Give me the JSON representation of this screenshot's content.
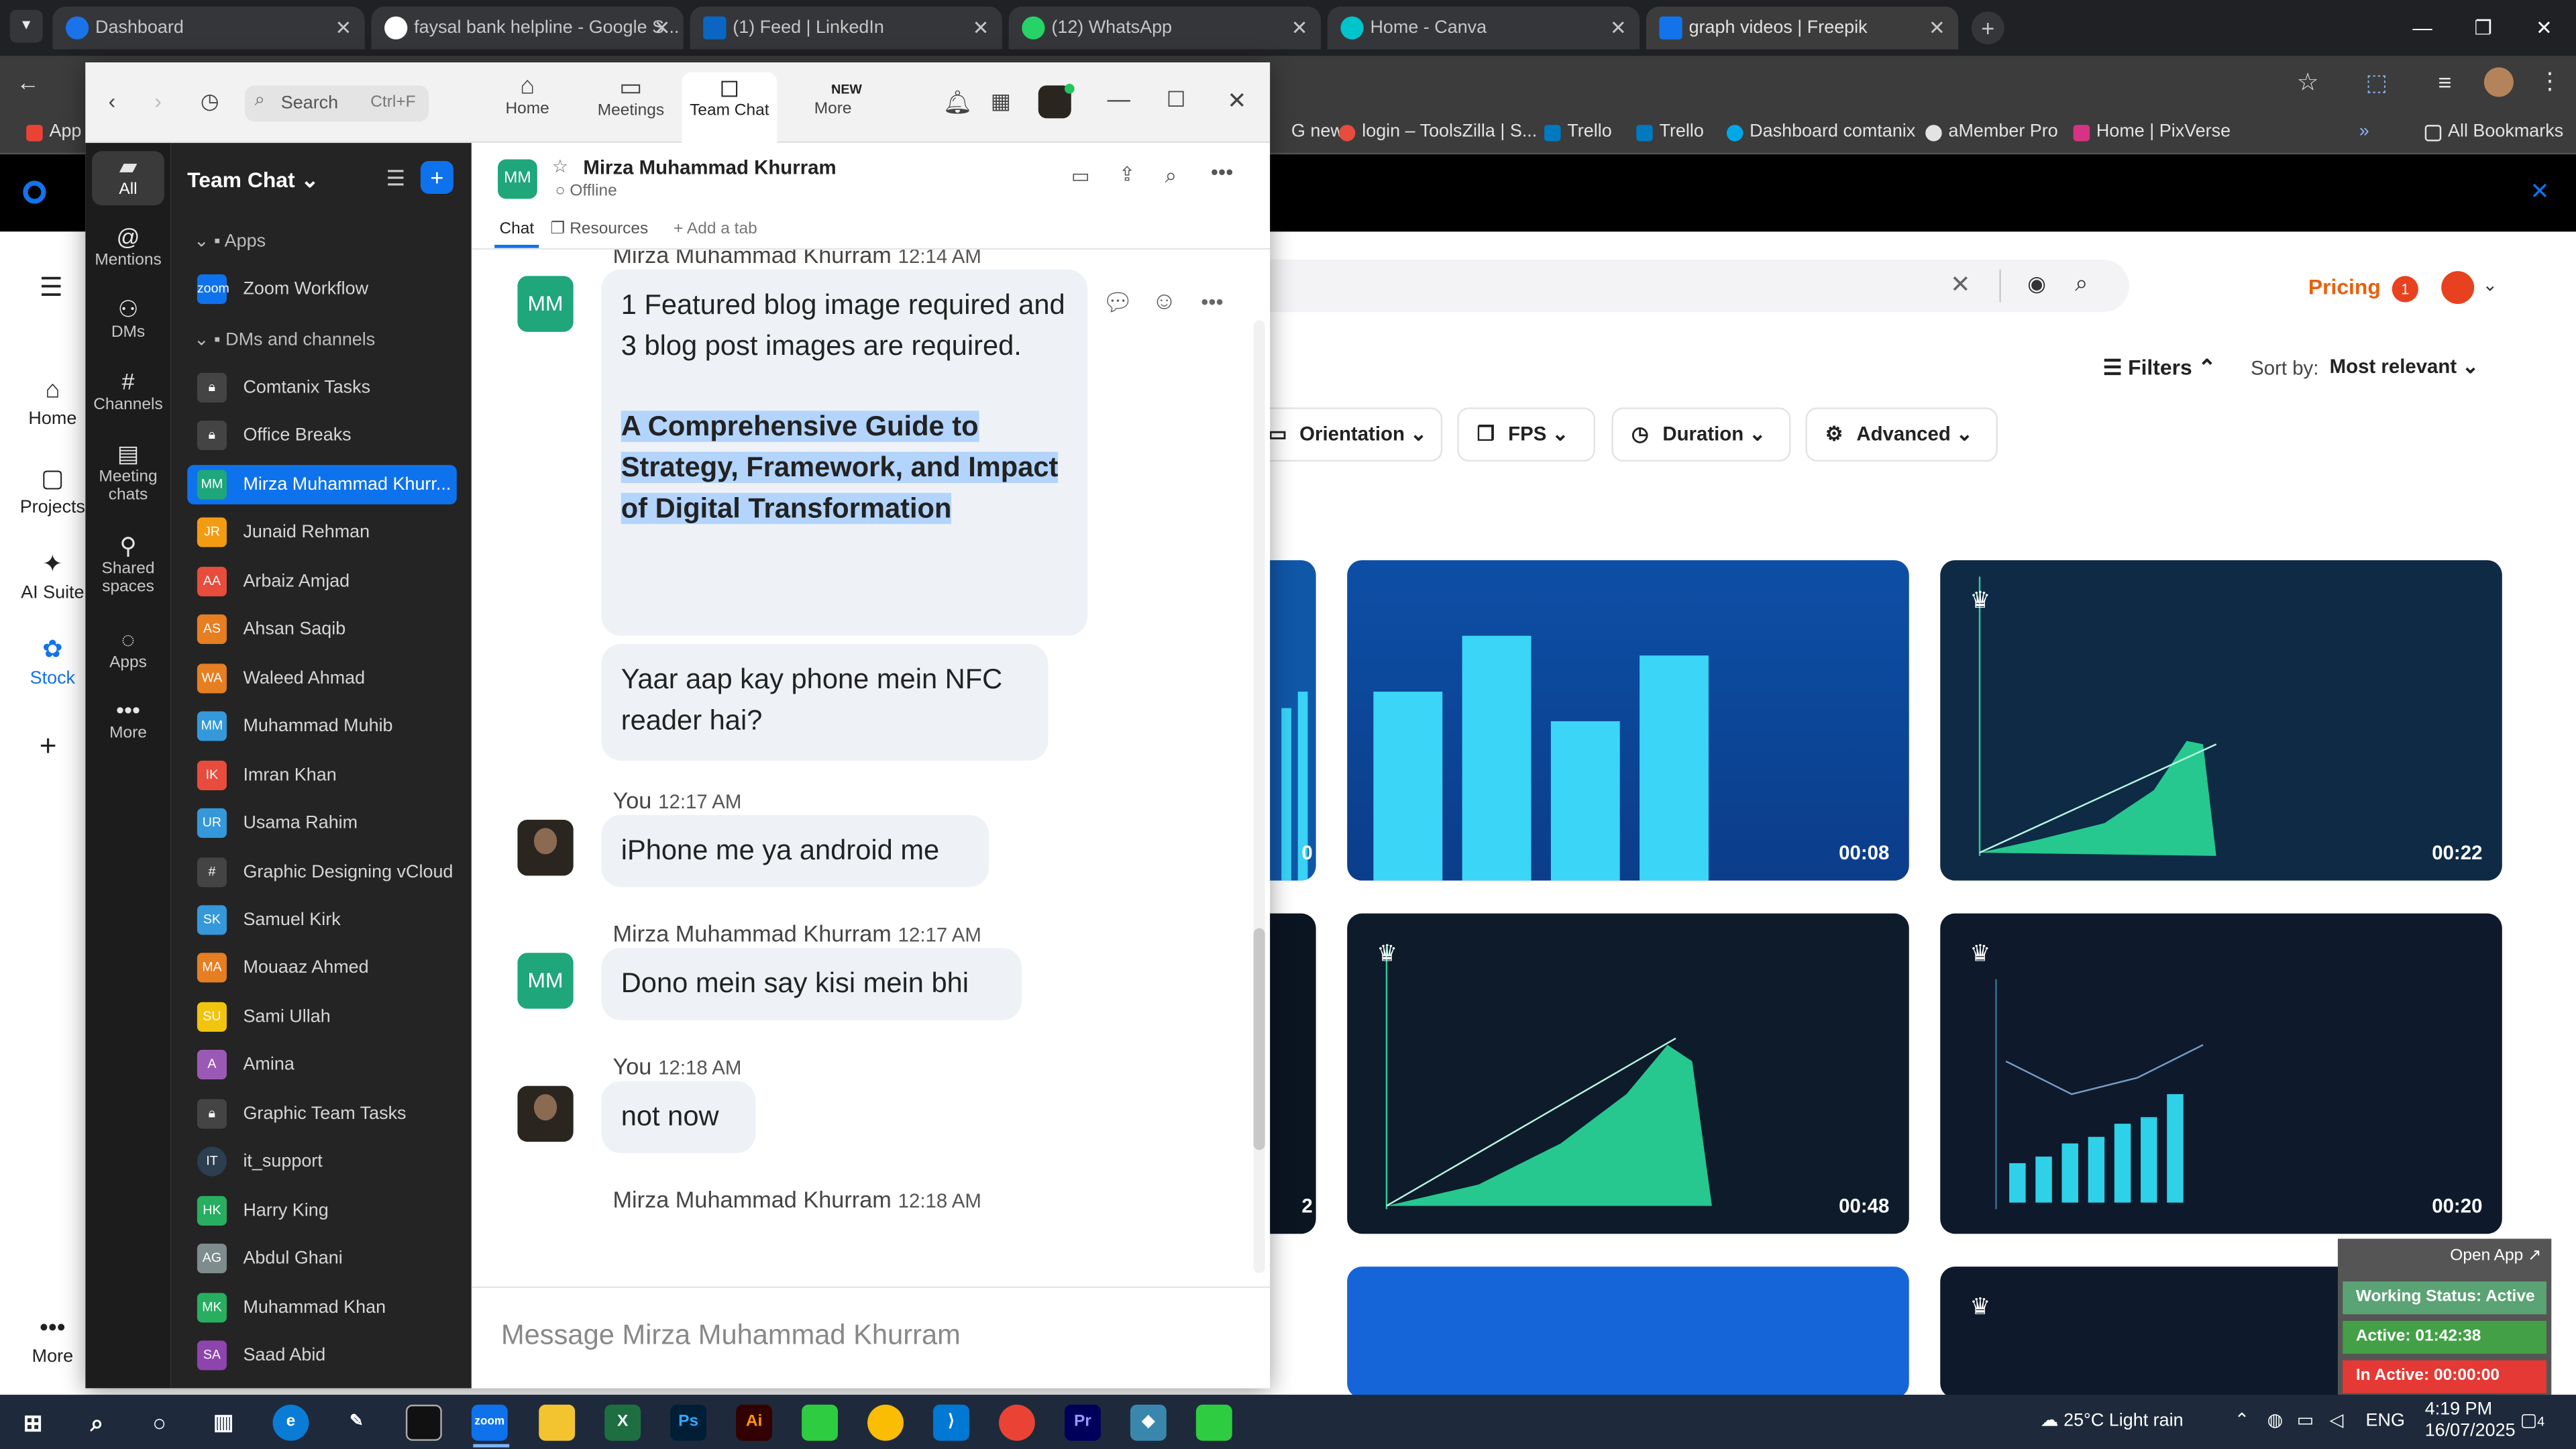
{
  "browser": {
    "tabs": [
      {
        "title": "Dashboard",
        "color": "#1a73e8"
      },
      {
        "title": "faysal bank helpline - Google S...",
        "color": "#ffffff"
      },
      {
        "title": "(1) Feed | LinkedIn",
        "color": "#0a66c2"
      },
      {
        "title": "(12) WhatsApp",
        "color": "#25d366"
      },
      {
        "title": "Home - Canva",
        "color": "#00c4cc"
      },
      {
        "title": "graph videos | Freepik",
        "color": "#1273eb"
      }
    ],
    "bookmarks": [
      "G new",
      "login – ToolsZilla | S...",
      "Trello",
      "Trello",
      "Dashboard comtanix",
      "aMember Pro",
      "Home | PixVerse"
    ],
    "all_bookmarks_label": "All Bookmarks",
    "apps_label": "App"
  },
  "freepik": {
    "left_nav": [
      {
        "icon": "home-icon",
        "label": "Home"
      },
      {
        "icon": "projects-icon",
        "label": "Projects"
      },
      {
        "icon": "ai-suite-icon",
        "label": "AI Suite"
      },
      {
        "icon": "stock-icon",
        "label": "Stock"
      },
      {
        "icon": "more-icon",
        "label": "More"
      }
    ],
    "pricing_label": "Pricing",
    "notification_count": "1",
    "filters_label": "Filters",
    "sort_label": "Sort by:",
    "sort_value": "Most relevant",
    "filter_buttons": [
      "Orientation",
      "FPS",
      "Duration",
      "Advanced"
    ],
    "thumbnails": [
      {
        "duration": "0"
      },
      {
        "duration": "00:08"
      },
      {
        "duration": "00:22"
      },
      {
        "duration": "2"
      },
      {
        "duration": "00:48"
      },
      {
        "duration": "00:20"
      }
    ]
  },
  "zoom": {
    "search_placeholder": "Search",
    "search_shortcut": "Ctrl+F",
    "top_tabs": [
      {
        "icon": "home-icon",
        "label": "Home"
      },
      {
        "icon": "meetings-icon",
        "label": "Meetings"
      },
      {
        "icon": "team-chat-icon",
        "label": "Team Chat"
      },
      {
        "icon": "more-icon",
        "label": "More"
      }
    ],
    "new_badge": "NEW",
    "rail": [
      {
        "icon": "all-icon",
        "label": "All"
      },
      {
        "icon": "mentions-icon",
        "label": "Mentions"
      },
      {
        "icon": "dms-icon",
        "label": "DMs"
      },
      {
        "icon": "channels-icon",
        "label": "Channels"
      },
      {
        "icon": "meeting-chats-icon",
        "label": "Meeting chats"
      },
      {
        "icon": "shared-spaces-icon",
        "label": "Shared spaces"
      },
      {
        "icon": "apps-icon",
        "label": "Apps"
      },
      {
        "icon": "more-icon",
        "label": "More"
      }
    ],
    "list_title": "Team Chat",
    "apps_section": "Apps",
    "zoom_workflow": "Zoom Workflow",
    "dms_section": "DMs and channels",
    "chats": [
      {
        "name": "Comtanix Tasks",
        "av": "",
        "color": "#555555"
      },
      {
        "name": "Office Breaks",
        "av": "",
        "color": "#555555"
      },
      {
        "name": "Mirza Muhammad Khurr...",
        "av": "MM",
        "color": "#1fa67a"
      },
      {
        "name": "Junaid Rehman",
        "av": "JR",
        "color": "#f39c12"
      },
      {
        "name": "Arbaiz Amjad",
        "av": "AA",
        "color": "#e74c3c"
      },
      {
        "name": "Ahsan Saqib",
        "av": "AS",
        "color": "#e67e22"
      },
      {
        "name": "Waleed Ahmad",
        "av": "WA",
        "color": "#e67e22"
      },
      {
        "name": "Muhammad Muhib",
        "av": "MM",
        "color": "#3498db"
      },
      {
        "name": "Imran Khan",
        "av": "IK",
        "color": "#e74c3c"
      },
      {
        "name": "Usama Rahim",
        "av": "UR",
        "color": "#3498db"
      },
      {
        "name": "Graphic Designing vCloud",
        "av": "#",
        "color": "#555555"
      },
      {
        "name": "Samuel Kirk",
        "av": "SK",
        "color": "#3498db"
      },
      {
        "name": "Mouaaz Ahmed",
        "av": "MA",
        "color": "#e67e22"
      },
      {
        "name": "Sami Ullah",
        "av": "SU",
        "color": "#f1c40f"
      },
      {
        "name": "Amina",
        "av": "A",
        "color": "#9b59b6"
      },
      {
        "name": "Graphic Team Tasks",
        "av": "",
        "color": "#555555"
      },
      {
        "name": "it_support",
        "av": "IT",
        "color": "#2c3e50"
      },
      {
        "name": "Harry King",
        "av": "HK",
        "color": "#27ae60"
      },
      {
        "name": "Abdul Ghani",
        "av": "AG",
        "color": "#7f8c8d"
      },
      {
        "name": "Muhammad Khan",
        "av": "MK",
        "color": "#27ae60"
      },
      {
        "name": "Saad Abid",
        "av": "SA",
        "color": "#8e44ad"
      }
    ],
    "header": {
      "avatar": "MM",
      "name": "Mirza Muhammad Khurram",
      "status": "Offline",
      "tabs": [
        "Chat",
        "Resources",
        "Add a tab"
      ]
    },
    "messages": {
      "m1_sender": "Mirza Muhammad Khurram",
      "m1_time": "12:14 AM",
      "m1_avatar": "MM",
      "m1_text": "1 Featured blog image required and 3 blog post images are required.",
      "m1_highlight": "A Comprehensive Guide to Strategy, Framework, and Impact of Digital Transformation",
      "m2_text": "Yaar aap kay phone mein NFC reader hai?",
      "m3_sender": "You",
      "m3_time": "12:17 AM",
      "m3_text": "iPhone me ya android me",
      "m4_sender": "Mirza Muhammad Khurram",
      "m4_time": "12:17 AM",
      "m4_avatar": "MM",
      "m4_text": "Dono mein say kisi mein bhi",
      "m5_sender": "You",
      "m5_time": "12:18 AM",
      "m5_text": "not now",
      "m6_sender": "Mirza Muhammad Khurram",
      "m6_time": "12:18 AM"
    },
    "composer_placeholder": "Message Mirza Muhammad Khurram"
  },
  "status_widget": {
    "open_app": "Open App",
    "working": "Working Status: Active",
    "active": "Active: 01:42:38",
    "inactive": "In Active: 00:00:00"
  },
  "taskbar": {
    "weather": "25°C  Light rain",
    "lang": "ENG",
    "time": "4:19 PM",
    "date": "16/07/2025",
    "notifications": "4"
  }
}
